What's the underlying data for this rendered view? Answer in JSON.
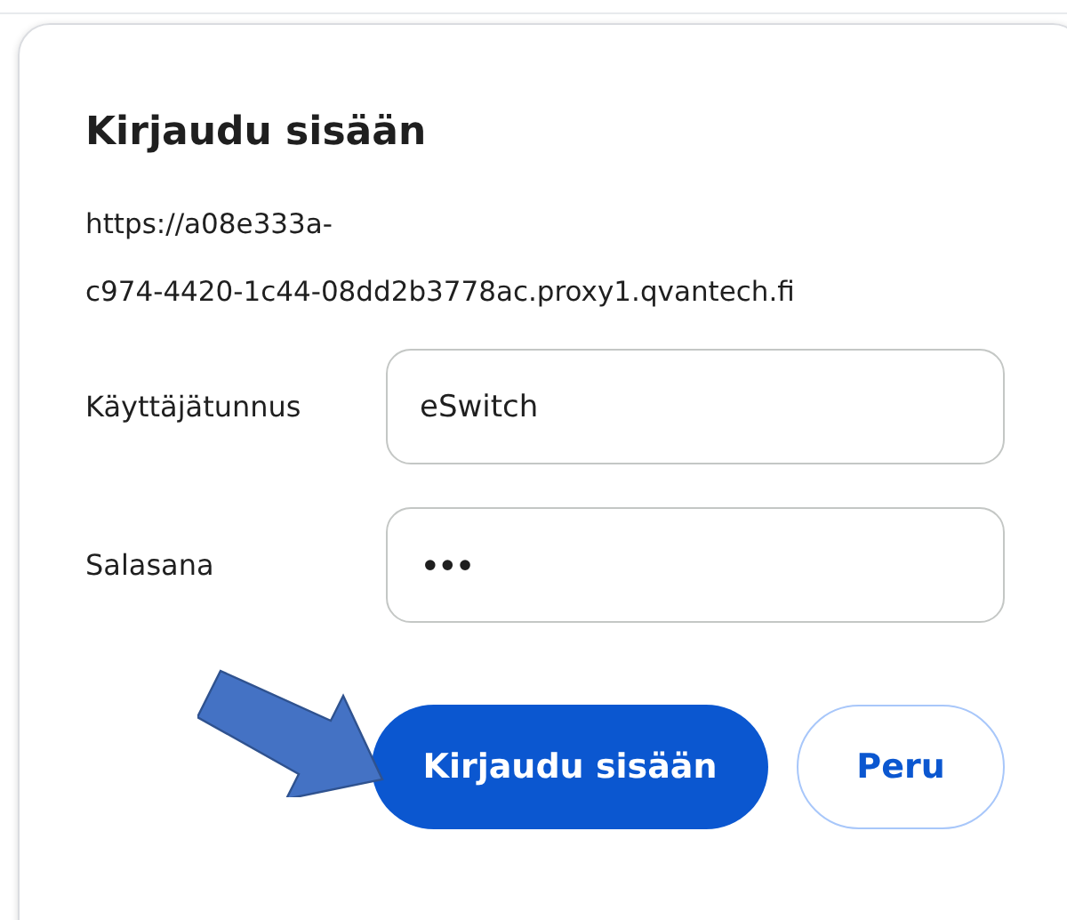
{
  "dialog": {
    "title": "Kirjaudu sisään",
    "url_lines": [
      "https://a08e333a-",
      "c974-4420-1c44-08dd2b3778ac.proxy1.qvantech.fi"
    ],
    "fields": [
      {
        "label": "Käyttäjätunnus",
        "kind": "text",
        "value": "eSwitch"
      },
      {
        "label": "Salasana",
        "kind": "password",
        "value": "•••"
      }
    ],
    "buttons": [
      {
        "label": "Kirjaudu sisään",
        "kind": "primary"
      },
      {
        "label": "Peru",
        "kind": "secondary"
      }
    ]
  }
}
